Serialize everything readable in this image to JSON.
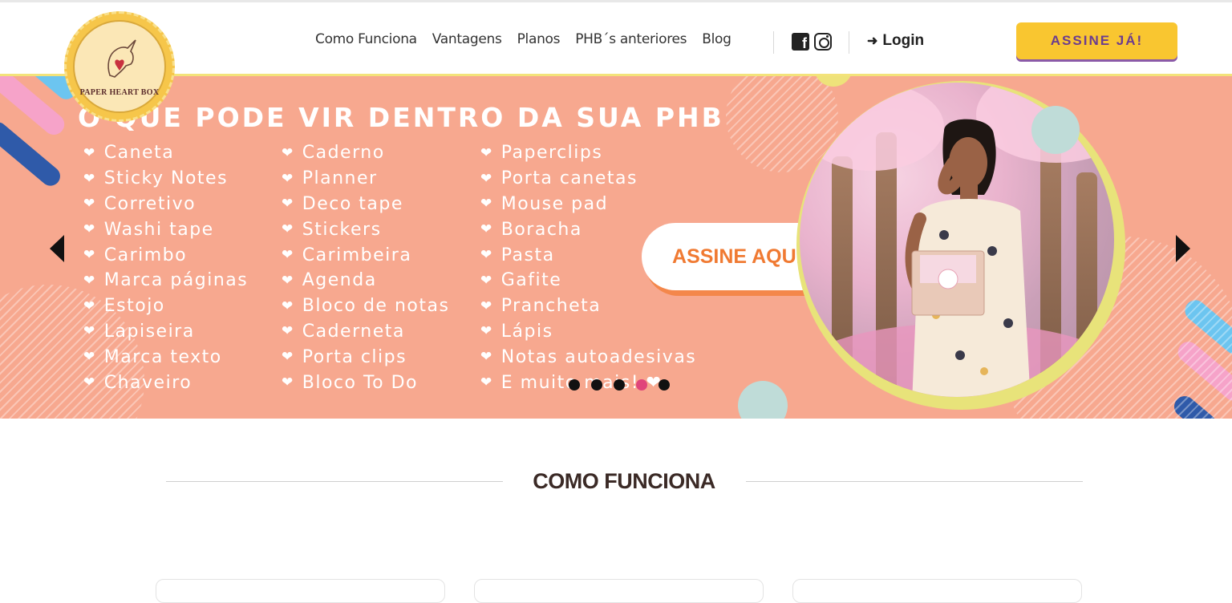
{
  "logo": {
    "text": "PAPER HEART BOX"
  },
  "nav": {
    "items": [
      "Como Funciona",
      "Vantagens",
      "Planos",
      "PHB´s anteriores",
      "Blog"
    ],
    "login_label": "Login",
    "cta_label": "ASSINE JÁ!"
  },
  "banner": {
    "title": "O QUE PODE VIR DENTRO DA SUA PHB",
    "col1": [
      "Caneta",
      "Sticky Notes",
      "Corretivo",
      "Washi tape",
      "Carimbo",
      "Marca páginas",
      "Estojo",
      "Lapiseira",
      "Marca texto",
      "Chaveiro"
    ],
    "col2": [
      "Caderno",
      "Planner",
      "Deco tape",
      "Stickers",
      "Carimbeira",
      "Agenda",
      "Bloco de notas",
      "Caderneta",
      "Porta clips",
      "Bloco To Do"
    ],
    "col3": [
      "Paperclips",
      "Porta canetas",
      "Mouse pad",
      "Boracha",
      "Pasta",
      "Gafite",
      "Prancheta",
      "Lápis",
      "Notas autoadesivas",
      "E muito mais! ❤"
    ],
    "cta_label": "ASSINE AQUI!",
    "slide_count": 5,
    "active_slide": 4
  },
  "section": {
    "title": "COMO FUNCIONA"
  },
  "colors": {
    "banner_bg": "#f7a88f",
    "cta_yellow": "#f9c630",
    "cta_purple": "#6b3c8f",
    "accent_orange": "#f07a32",
    "active_dot": "#e0457b"
  }
}
